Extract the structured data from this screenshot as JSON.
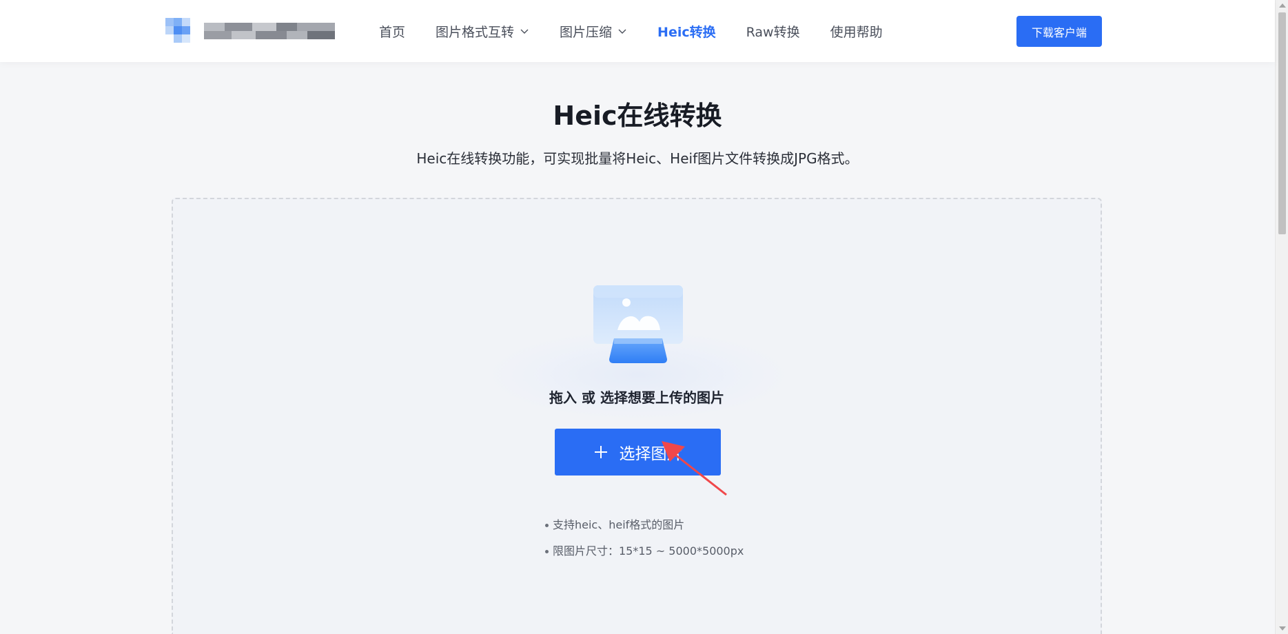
{
  "header": {
    "nav": [
      {
        "label": "首页",
        "dropdown": false,
        "active": false
      },
      {
        "label": "图片格式互转",
        "dropdown": true,
        "active": false
      },
      {
        "label": "图片压缩",
        "dropdown": true,
        "active": false
      },
      {
        "label": "Heic转换",
        "dropdown": false,
        "active": true
      },
      {
        "label": "Raw转换",
        "dropdown": false,
        "active": false
      },
      {
        "label": "使用帮助",
        "dropdown": false,
        "active": false
      }
    ],
    "download_label": "下载客户端"
  },
  "main": {
    "title": "Heic在线转换",
    "subtitle": "Heic在线转换功能，可实现批量将Heic、Heif图片文件转换成JPG格式。",
    "upload": {
      "prompt": "拖入 或 选择想要上传的图片",
      "button_label": "选择图片",
      "button_icon": "plus-icon",
      "notes": [
        "支持heic、heif格式的图片",
        "限图片尺寸：15*15 ~ 5000*5000px"
      ]
    }
  },
  "colors": {
    "accent": "#2a6df4",
    "annotation_arrow": "#f0474a"
  }
}
